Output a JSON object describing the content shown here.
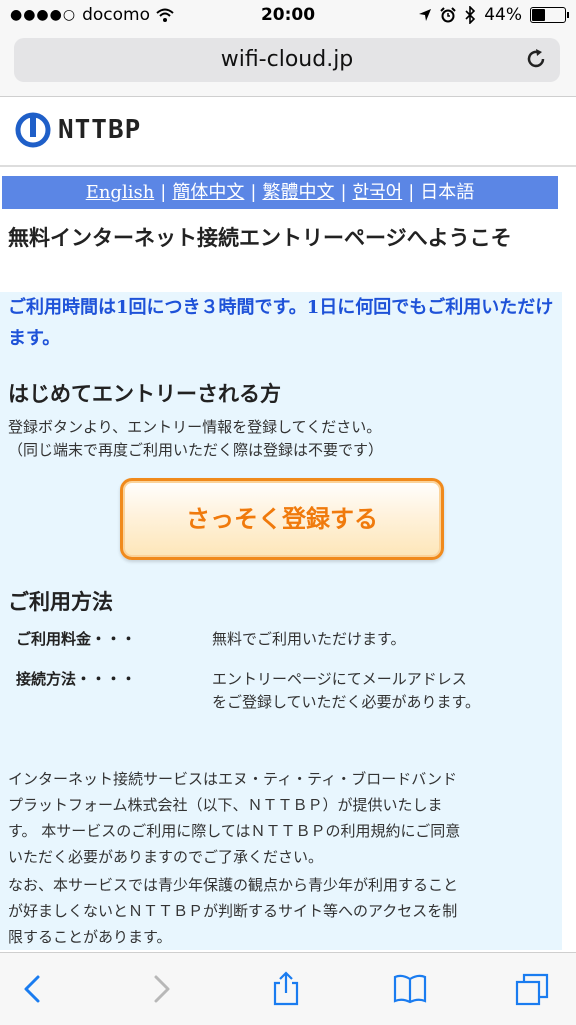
{
  "status": {
    "carrier": "docomo",
    "time": "20:00",
    "battery": "44%",
    "battery_level": 0.44
  },
  "browser": {
    "url": "wifi-cloud.jp"
  },
  "header": {
    "logo_text": "NTTBP"
  },
  "languages": {
    "english": "English",
    "simplified_chinese": "簡体中文",
    "traditional_chinese": "繁體中文",
    "korean": "한국어",
    "japanese": "日本語",
    "separator": "|"
  },
  "welcome_title": "無料インターネット接続エントリーページへようこそ",
  "notice": "ご利用時間は1回につき３時間です。1日に何回でもご利用いただけます。",
  "first_entry": {
    "title": "はじめてエントリーされる方",
    "line1": "登録ボタンより、エントリー情報を登録してください。",
    "line2": "（同じ端末で再度ご利用いただく際は登録は不要です）",
    "button": "さっそく登録する"
  },
  "usage": {
    "title": "ご利用方法",
    "fee_label": "ご利用料金・・・",
    "fee_value": "無料でご利用いただけます。",
    "method_label": "接続方法・・・・",
    "method_value_1": "エントリーページにてメールアドレス",
    "method_value_2": "をご登録していただく必要があります。"
  },
  "legal": {
    "p1_l1": "インターネット接続サービスはエヌ・ティ・ティ・ブロードバンド",
    "p1_l2": "プラットフォーム株式会社（以下、ＮＴＴＢＰ）が提供いたしま",
    "p1_l3": "す。 本サービスのご利用に際してはＮＴＴＢＰの利用規約にご同意",
    "p1_l4": "いただく必要がありますのでご了承ください。",
    "p2_l1": "なお、本サービスでは青少年保護の観点から青少年が利用すること",
    "p2_l2": "が好ましくないとＮＴＴＢＰが判断するサイト等へのアクセスを制",
    "p2_l3": "限することがあります。"
  },
  "colors": {
    "lang_bar": "#5b86e5",
    "panel": "#e8f6fe",
    "notice": "#1e52d8",
    "button_border": "#f08a1c",
    "ios_blue": "#1a7cf0"
  }
}
